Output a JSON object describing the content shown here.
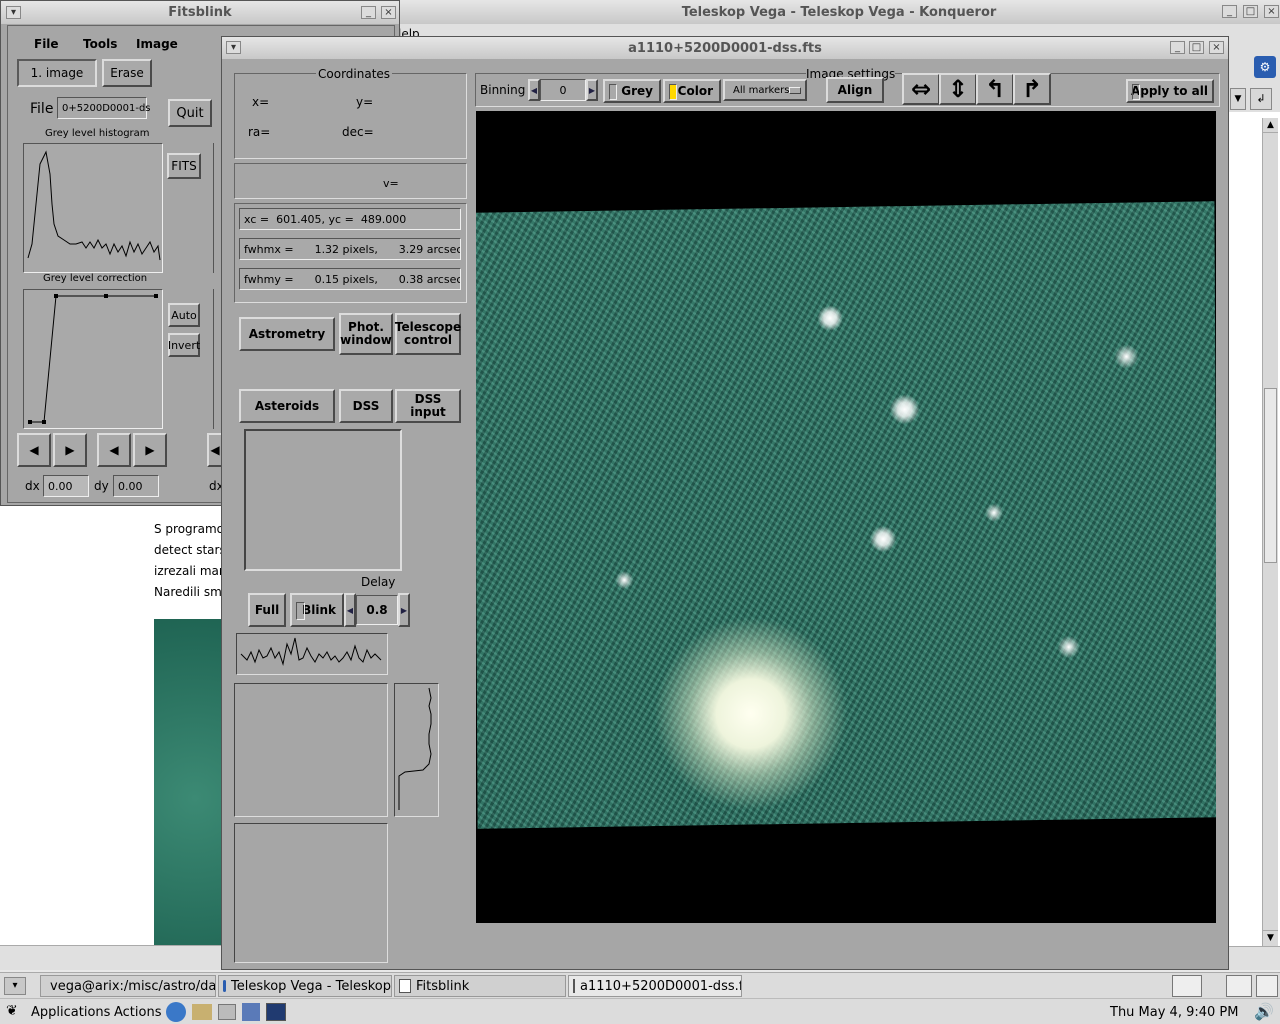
{
  "konqueror": {
    "title": "Teleskop Vega - Teleskop Vega - Konqueror",
    "menu_partial": "lelp",
    "page_lines": [
      "S programo",
      "detect stars",
      "izrezali mar",
      "Naredili sm"
    ]
  },
  "fitsblink": {
    "title": "Fitsblink",
    "menu": [
      "File",
      "Tools",
      "Image"
    ],
    "image_button": "1. image",
    "erase_button": "Erase",
    "file_label": "File",
    "file_value": "0+5200D0001-ds",
    "quit_button": "Quit",
    "fits_button": "FITS",
    "histogram_label": "Grey level histogram",
    "correction_label": "Grey level correction",
    "auto_button": "Auto",
    "invert_button": "Invert",
    "dx_label": "dx",
    "dx_value": "0.00",
    "dy_label": "dy",
    "dy_value": "0.00",
    "dx2_label": "dx"
  },
  "fits_window": {
    "title": "a1110+5200D0001-dss.fts",
    "coords": {
      "title": "Coordinates",
      "x": "x=",
      "y": "y=",
      "ra": "ra=",
      "dec": "dec=",
      "v": "v="
    },
    "centroid": "xc =  601.405, yc =  489.000",
    "fwhmx": "fwhmx =      1.32 pixels,      3.29 arcsec",
    "fwhmy": "fwhmy =      0.15 pixels,      0.38 arcsec",
    "buttons": {
      "astrometry": "Astrometry",
      "phot_line1": "Phot.",
      "phot_line2": "window",
      "tel_line1": "Telescope",
      "tel_line2": "control",
      "asteroids": "Asteroids",
      "dss": "DSS",
      "dss_input": "DSS input",
      "full": "Full",
      "blink": "Blink"
    },
    "delay_label": "Delay",
    "delay_value": "0.8",
    "settings": {
      "title": "Image settings",
      "binning_label": "Binning",
      "binning_value": "0",
      "grey": "Grey",
      "color": "Color",
      "markers": "All markers",
      "align": "Align",
      "apply_all": "Apply to all"
    }
  },
  "taskbar": {
    "tasks": [
      "vega@arix:/misc/astro/da",
      "Teleskop Vega - Teleskop",
      "Fitsblink",
      "a1110+5200D0001-dss.fts"
    ],
    "menu": [
      "Applications",
      "Actions"
    ],
    "clock": "Thu May  4,  9:40 PM"
  },
  "colors": {
    "sky": "#0c3a36",
    "star": "#e8f0e0"
  }
}
